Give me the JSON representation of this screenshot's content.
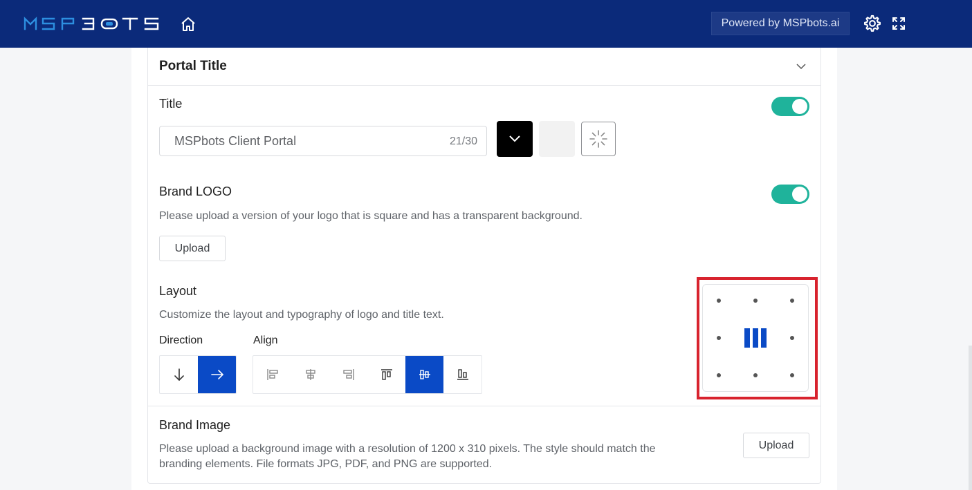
{
  "header": {
    "logo_text": "MSPBOTS",
    "powered_label": "Powered by MSPbots.ai"
  },
  "icons": {
    "home": "home-icon",
    "settings": "gear-icon",
    "fullscreen": "fullscreen-icon",
    "collapse": "chevron-down-icon"
  },
  "section": {
    "title": "Portal Title"
  },
  "title_field": {
    "label": "Title",
    "enabled": true,
    "value": "MSPbots Client Portal",
    "char_count": "21/30",
    "colors": [
      "#000000",
      "#f2f2f2"
    ]
  },
  "brand_logo": {
    "label": "Brand LOGO",
    "enabled": true,
    "description": "Please upload a version of your logo that is square and has a transparent background.",
    "upload_label": "Upload"
  },
  "layout": {
    "label": "Layout",
    "description": "Customize the layout and typography of logo and title text.",
    "direction_label": "Direction",
    "align_label": "Align",
    "direction_options": [
      "arrow-down-icon",
      "arrow-right-icon"
    ],
    "direction_selected": 1,
    "align_options": [
      "align-left-icon",
      "align-center-horizontal-icon",
      "align-right-icon",
      "align-top-icon",
      "align-center-vertical-icon",
      "align-bottom-icon"
    ],
    "align_selected": 4,
    "position_selected": "center"
  },
  "brand_image": {
    "label": "Brand Image",
    "description_line1": "Please upload a background image with a resolution of 1200 x 310 pixels. The style should match the",
    "description_line2": "branding elements. File formats JPG, PDF, and PNG are supported.",
    "upload_label": "Upload"
  },
  "theme": {
    "header_bg": "#0b2a7a",
    "accent": "#0a4ac6",
    "toggle_on": "#1fb39b",
    "highlight": "#d8232e"
  }
}
